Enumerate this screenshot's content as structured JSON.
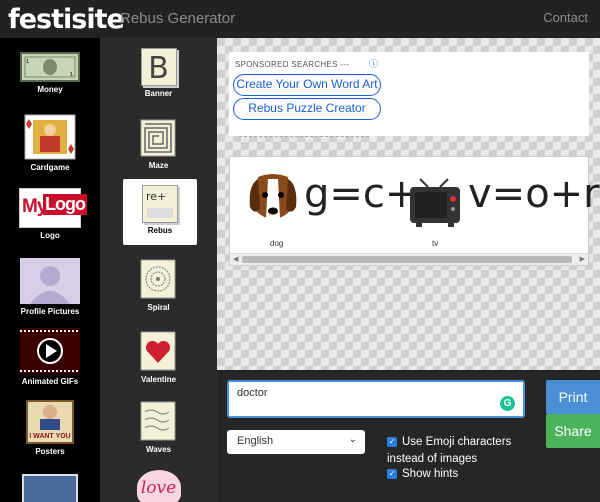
{
  "header": {
    "logo": "festisite",
    "title": "Rebus Generator",
    "contact": "Contact"
  },
  "col1": [
    "Money",
    "Cardgame",
    "Logo",
    "Profile Pictures",
    "Animated GIFs",
    "Posters"
  ],
  "col2": [
    "Banner",
    "Maze",
    "Rebus",
    "Spiral",
    "Valentine",
    "Waves"
  ],
  "logo_thumb": {
    "my": "My",
    "logo": "Logo"
  },
  "poster_thumb": "I WANT YOU",
  "banner_letter": "B",
  "rebus_thumb": "re+",
  "love_thumb": "love",
  "ad": {
    "sponsored": "SPONSORED SEARCHES ---",
    "info": "ⓘ",
    "link1": "Create Your Own Word Art",
    "link2": "Rebus Puzzle Creator"
  },
  "puzzle": {
    "part1": "g=c+",
    "part2": "v=o+r",
    "hint1": "dog",
    "hint2": "tv"
  },
  "controls": {
    "input_value": "doctor",
    "language": "English",
    "opt1": "Use Emoji characters instead of images",
    "opt2": "Show hints",
    "print": "Print",
    "share": "Share"
  }
}
